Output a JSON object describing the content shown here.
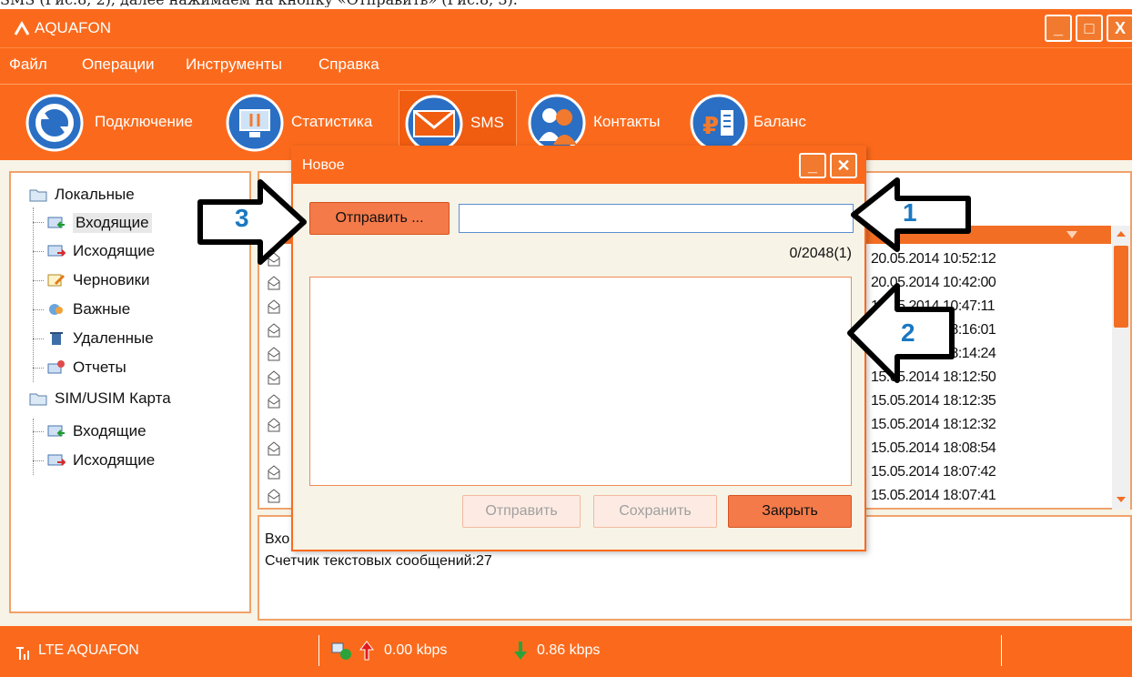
{
  "caption": "SMS (Рис.8, 2), далее нажимаем на кнопку «Отправить» (Рис.8, 3).",
  "app": {
    "title": "AQUAFON"
  },
  "window_buttons": [
    "_",
    "□",
    "X"
  ],
  "menu": [
    "Файл",
    "Операции",
    "Инструменты",
    "Справка"
  ],
  "toolbar": [
    {
      "label": "Подключение",
      "icon": "connection-icon"
    },
    {
      "label": "Статистика",
      "icon": "statistics-icon"
    },
    {
      "label": "SMS",
      "icon": "sms-icon"
    },
    {
      "label": "Контакты",
      "icon": "contacts-icon"
    },
    {
      "label": "Баланс",
      "icon": "balance-icon"
    }
  ],
  "tree": {
    "local": "Локальные",
    "local_items": [
      "Входящие",
      "Исходящие",
      "Черновики",
      "Важные",
      "Удаленные",
      "Отчеты"
    ],
    "sim": "SIM/USIM Карта",
    "sim_items": [
      "Входящие",
      "Исходящие"
    ]
  },
  "list": {
    "dates": [
      "20.05.2014 10:52:12",
      "20.05.2014 10:42:00",
      "18.05.2014 10:47:11",
      "15.05.2014 18:16:01",
      "15.05.2014 18:14:24",
      "15.05.2014 18:12:50",
      "15.05.2014 18:12:35",
      "15.05.2014 18:12:32",
      "15.05.2014 18:08:54",
      "15.05.2014 18:07:42",
      "15.05.2014 18:07:41"
    ]
  },
  "detail": {
    "line1": "Вхо",
    "line2": "Счетчик текстовых сообщений:27"
  },
  "status": {
    "network": "LTE AQUAFON",
    "upload": "0.00 kbps",
    "download": "0.86 kbps"
  },
  "dialog": {
    "title": "Новое",
    "send_to_label": "Отправить ...",
    "recipient_value": "",
    "counter": "0/2048(1)",
    "message_value": "",
    "send_label": "Отправить",
    "save_label": "Сохранить",
    "close_label": "Закрыть"
  },
  "annotations": [
    "1",
    "2",
    "3"
  ],
  "colors": {
    "accent": "#fb6a1c",
    "accent_dark": "#f05c10",
    "arrow_number": "#1a78c2"
  }
}
